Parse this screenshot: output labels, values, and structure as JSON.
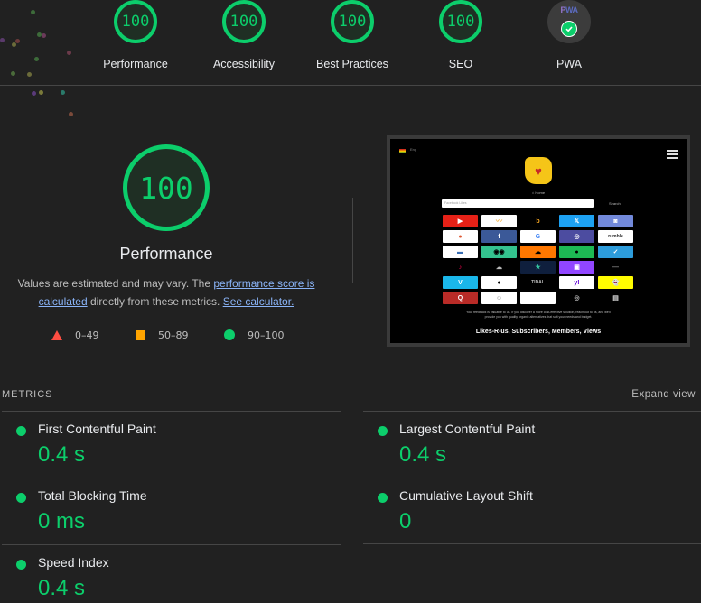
{
  "categories": [
    {
      "name": "Performance",
      "score": "100"
    },
    {
      "name": "Accessibility",
      "score": "100"
    },
    {
      "name": "Best Practices",
      "score": "100"
    },
    {
      "name": "SEO",
      "score": "100"
    },
    {
      "name": "PWA",
      "badge": "PWA",
      "status": "pass"
    }
  ],
  "performance": {
    "score": "100",
    "title": "Performance",
    "desc_prefix": "Values are estimated and may vary. The ",
    "link_score": "performance score is calculated",
    "desc_middle": " directly from these metrics. ",
    "link_calculator": "See calculator.",
    "legend": [
      {
        "shape": "triangle",
        "range": "0–49",
        "color": "#ff4e42"
      },
      {
        "shape": "square",
        "range": "50–89",
        "color": "#ffa400"
      },
      {
        "shape": "circle",
        "range": "90–100",
        "color": "#0cce6b"
      }
    ]
  },
  "screenshot": {
    "language": "Eng",
    "home_link": "⌂ Home",
    "search_placeholder": "Facebook Likes",
    "search_button": "Search",
    "tiles": [
      {
        "label": "▶",
        "bg": "#e62117",
        "fg": "#fff"
      },
      {
        "label": "〰",
        "bg": "#ffffff",
        "fg": "#f5a623"
      },
      {
        "label": "b",
        "bg": "#000000",
        "fg": "#f5a623"
      },
      {
        "label": "𝕏",
        "bg": "#1da1f2",
        "fg": "#fff"
      },
      {
        "label": "◙",
        "bg": "#7289da",
        "fg": "#fff"
      },
      {
        "label": "●",
        "bg": "#ffffff",
        "fg": "#de5833"
      },
      {
        "label": "f",
        "bg": "#3b5998",
        "fg": "#fff"
      },
      {
        "label": "G",
        "bg": "#ffffff",
        "fg": "#4285f4"
      },
      {
        "label": "◎",
        "bg": "#4c4ca0",
        "fg": "#fff"
      },
      {
        "label": "rumble",
        "bg": "#ffffff",
        "fg": "#2b2b2b"
      },
      {
        "label": "▬",
        "bg": "#ffffff",
        "fg": "#3a6fb5"
      },
      {
        "label": "◉◉",
        "bg": "#34c38f",
        "fg": "#000"
      },
      {
        "label": "☁",
        "bg": "#ff7700",
        "fg": "#000"
      },
      {
        "label": "●",
        "bg": "#1db954",
        "fg": "#000"
      },
      {
        "label": "✓",
        "bg": "#2d9cdb",
        "fg": "#fff"
      },
      {
        "label": "♪",
        "bg": "#000000",
        "fg": "#ff0050"
      },
      {
        "label": "☁",
        "bg": "#000000",
        "fg": "#bbb"
      },
      {
        "label": "★",
        "bg": "#0f1f3d",
        "fg": "#35c6a0"
      },
      {
        "label": "▣",
        "bg": "#9146ff",
        "fg": "#fff"
      },
      {
        "label": "—",
        "bg": "#000000",
        "fg": "#888"
      },
      {
        "label": "V",
        "bg": "#1ab7ea",
        "fg": "#fff"
      },
      {
        "label": "●",
        "bg": "#ffffff",
        "fg": "#000"
      },
      {
        "label": "TIDAL",
        "bg": "#000000",
        "fg": "#bbb"
      },
      {
        "label": "y!",
        "bg": "#ffffff",
        "fg": "#6001d2"
      },
      {
        "label": "👻",
        "bg": "#fffc00",
        "fg": "#fff"
      },
      {
        "label": "Q",
        "bg": "#b92b27",
        "fg": "#fff"
      },
      {
        "label": "☺",
        "bg": "#ffffff",
        "fg": "#888"
      },
      {
        "label": "",
        "bg": "#ffffff",
        "fg": "#000"
      },
      {
        "label": "◎",
        "bg": "#000000",
        "fg": "#bbb"
      },
      {
        "label": "▤",
        "bg": "#000000",
        "fg": "#ddd"
      }
    ],
    "feedback": "Your feedback is valuable to us. If you discover a more cost-effective solution, reach out to us, and we'll provide you with quality organic alternatives that suit your needs and budget.",
    "title": "Likes-R-us, Subscribers, Members, Views"
  },
  "metrics": {
    "heading": "METRICS",
    "expand_label": "Expand view",
    "items": [
      {
        "name": "First Contentful Paint",
        "value": "0.4 s"
      },
      {
        "name": "Largest Contentful Paint",
        "value": "0.4 s"
      },
      {
        "name": "Total Blocking Time",
        "value": "0 ms"
      },
      {
        "name": "Cumulative Layout Shift",
        "value": "0"
      },
      {
        "name": "Speed Index",
        "value": "0.4 s"
      }
    ]
  }
}
